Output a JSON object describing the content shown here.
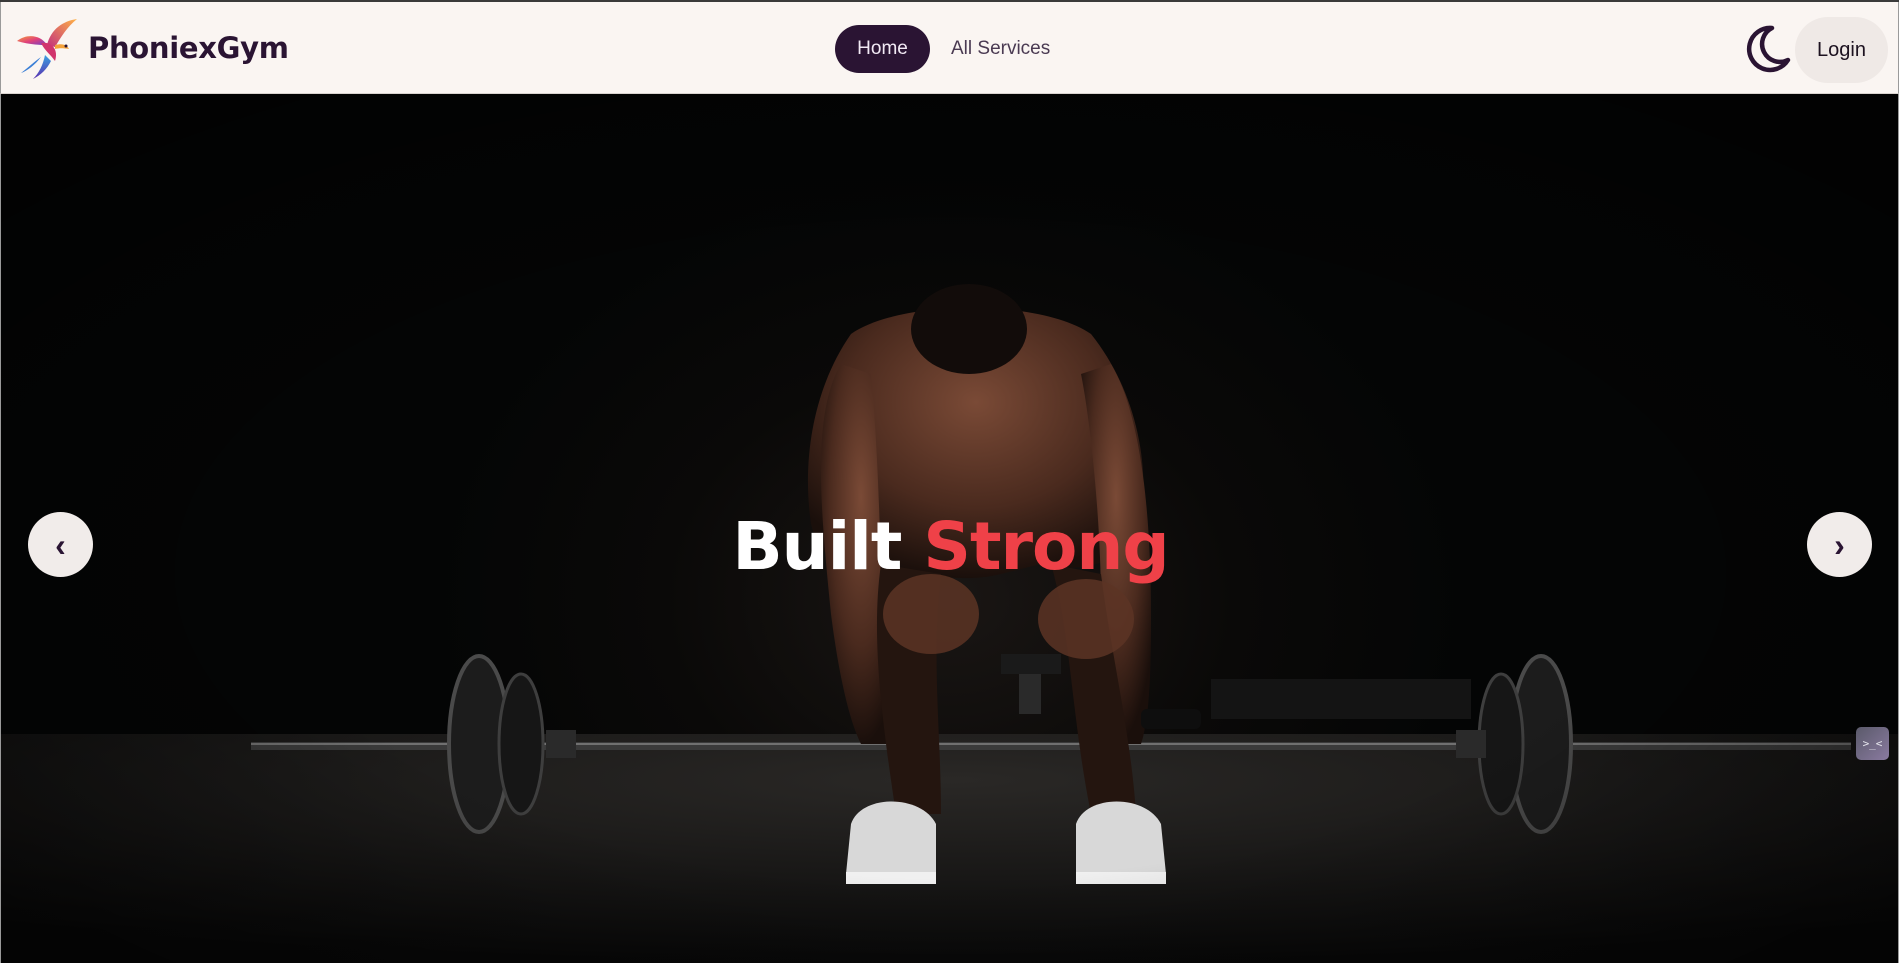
{
  "brand": {
    "name": "PhoniexGym",
    "logo_icon": "phoenix-bird-logo"
  },
  "nav": {
    "links": [
      {
        "label": "Home",
        "active": true
      },
      {
        "label": "All Services",
        "active": false
      }
    ]
  },
  "header_actions": {
    "theme_icon": "moon-icon",
    "login_label": "Login"
  },
  "hero": {
    "title_word1": "Built",
    "title_word2": "Strong",
    "prev_label": "‹",
    "next_label": "›",
    "extension_badge": ">_<"
  },
  "colors": {
    "brand_dark": "#2a1433",
    "accent_red": "#ef4148",
    "nav_bg": "#faf5f2"
  }
}
